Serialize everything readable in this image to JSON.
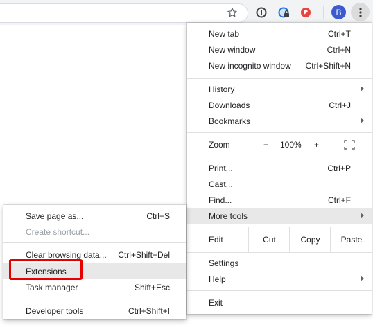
{
  "toolbar": {
    "star_icon": "star-outline",
    "ext_icons": [
      "onepassword-icon",
      "password-lock-icon",
      "red-extension-icon"
    ],
    "profile_initial": "B",
    "profile_color": "#3c5bd0",
    "menu_icon": "vertical-dots"
  },
  "main_menu": {
    "new_tab": {
      "label": "New tab",
      "shortcut": "Ctrl+T"
    },
    "new_window": {
      "label": "New window",
      "shortcut": "Ctrl+N"
    },
    "new_incognito": {
      "label": "New incognito window",
      "shortcut": "Ctrl+Shift+N"
    },
    "history": {
      "label": "History"
    },
    "downloads": {
      "label": "Downloads",
      "shortcut": "Ctrl+J"
    },
    "bookmarks": {
      "label": "Bookmarks"
    },
    "zoom": {
      "label": "Zoom",
      "minus": "−",
      "value": "100%",
      "plus": "+"
    },
    "print": {
      "label": "Print...",
      "shortcut": "Ctrl+P"
    },
    "cast": {
      "label": "Cast..."
    },
    "find": {
      "label": "Find...",
      "shortcut": "Ctrl+F"
    },
    "more_tools": {
      "label": "More tools"
    },
    "edit": {
      "label": "Edit",
      "cut": "Cut",
      "copy": "Copy",
      "paste": "Paste"
    },
    "settings": {
      "label": "Settings"
    },
    "help": {
      "label": "Help"
    },
    "exit": {
      "label": "Exit"
    }
  },
  "sub_menu": {
    "save_page": {
      "label": "Save page as...",
      "shortcut": "Ctrl+S"
    },
    "create_shortcut": {
      "label": "Create shortcut..."
    },
    "clear_data": {
      "label": "Clear browsing data...",
      "shortcut": "Ctrl+Shift+Del"
    },
    "extensions": {
      "label": "Extensions"
    },
    "task_manager": {
      "label": "Task manager",
      "shortcut": "Shift+Esc"
    },
    "dev_tools": {
      "label": "Developer tools",
      "shortcut": "Ctrl+Shift+I"
    }
  },
  "colors": {
    "highlight": "#e8e8e8",
    "annotation_red": "#e60000",
    "toolbar_bg": "#f1f3f4"
  }
}
